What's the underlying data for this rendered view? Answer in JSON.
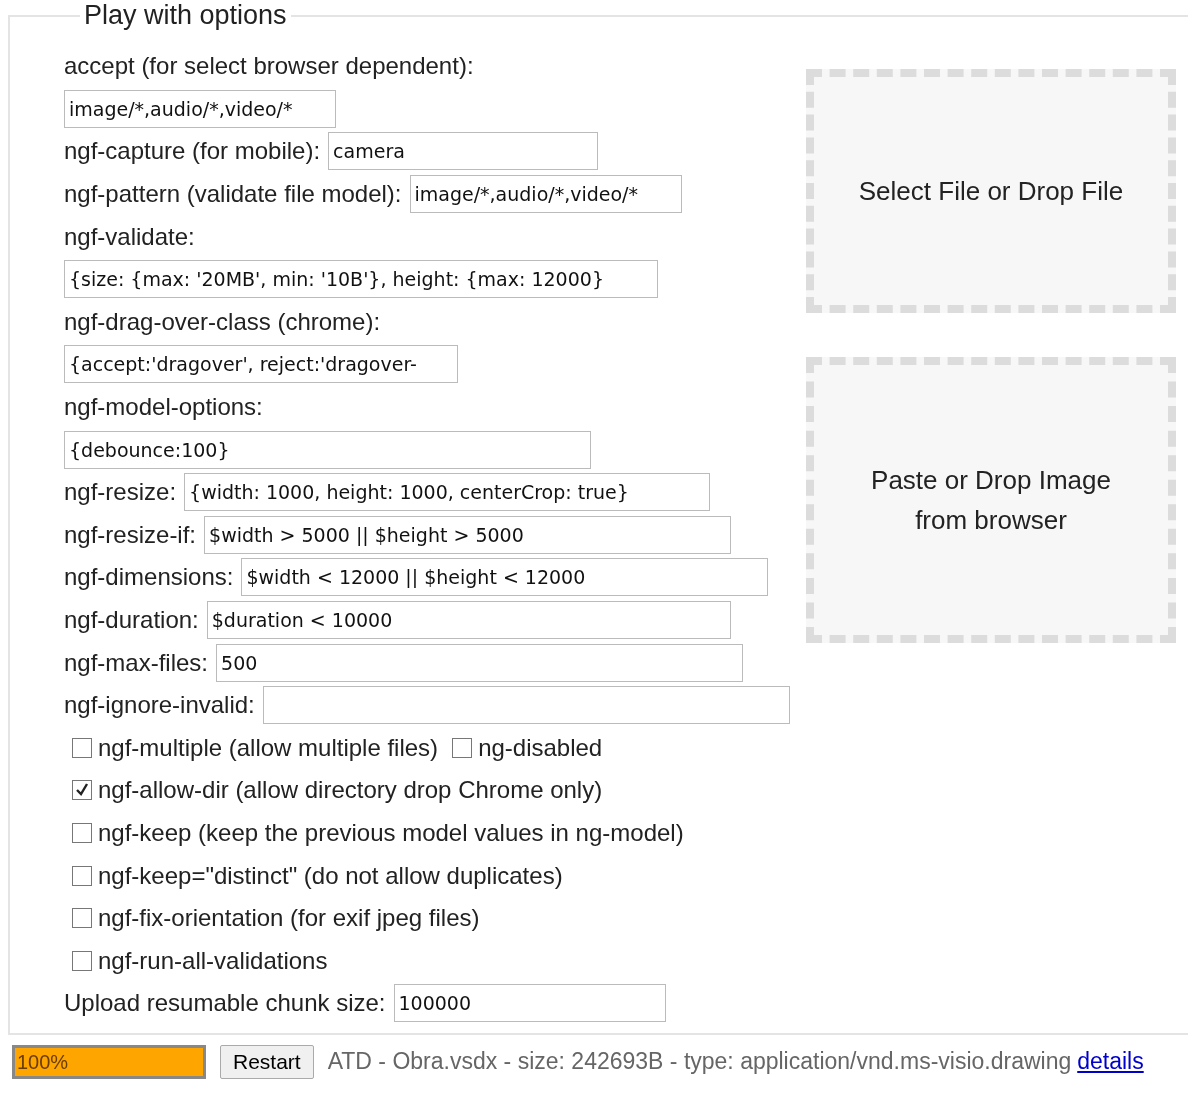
{
  "panel": {
    "title": "Play with options"
  },
  "fields": [
    {
      "kind": "stacked",
      "label": "accept (for select browser dependent):",
      "value": "image/*,audio/*,video/*"
    },
    {
      "kind": "inline",
      "label": "ngf-capture (for mobile):",
      "value": "camera"
    },
    {
      "kind": "inline",
      "label": "ngf-pattern (validate file model):",
      "value": "image/*,audio/*,video/*"
    },
    {
      "kind": "stacked",
      "label": "ngf-validate:",
      "value": "{size: {max: '20MB', min: '10B'}, height: {max: 12000}"
    },
    {
      "kind": "stacked",
      "label": "ngf-drag-over-class (chrome):",
      "value": "{accept:'dragover', reject:'dragover-"
    },
    {
      "kind": "stacked",
      "label": "ngf-model-options:",
      "value": "{debounce:100}"
    },
    {
      "kind": "inline",
      "label": "ngf-resize:",
      "value": "{width: 1000, height: 1000, centerCrop: true}"
    },
    {
      "kind": "inline",
      "label": "ngf-resize-if:",
      "value": "$width > 5000 || $height > 5000"
    },
    {
      "kind": "inline",
      "label": "ngf-dimensions:",
      "value": "$width < 12000 || $height < 12000"
    },
    {
      "kind": "inline",
      "label": "ngf-duration:",
      "value": "$duration < 10000"
    },
    {
      "kind": "inline",
      "label": "ngf-max-files:",
      "value": "500"
    },
    {
      "kind": "inline",
      "label": "ngf-ignore-invalid:"
    }
  ],
  "checkbox_rows": [
    [
      {
        "label": "ngf-multiple (allow multiple files)",
        "checked": false
      },
      {
        "label": "ng-disabled",
        "checked": false
      }
    ],
    [
      {
        "label": "ngf-allow-dir (allow directory drop Chrome only)",
        "checked": true
      }
    ],
    [
      {
        "label": "ngf-keep (keep the previous model values in ng-model)",
        "checked": false
      }
    ],
    [
      {
        "label": "ngf-keep=\"distinct\" (do not allow duplicates)",
        "checked": false
      }
    ],
    [
      {
        "label": "ngf-fix-orientation (for exif jpeg files)",
        "checked": false
      }
    ],
    [
      {
        "label": "ngf-run-all-validations",
        "checked": false
      }
    ]
  ],
  "chunk_field": {
    "label": "Upload resumable chunk size:",
    "value": "100000"
  },
  "drop_zones": [
    {
      "text": "Select File or Drop File"
    },
    {
      "text": "Paste or Drop Image from browser"
    }
  ],
  "upload": {
    "progress": {
      "level": 1,
      "text": "100%"
    },
    "restart_button": "Restart",
    "file_info": "ATD - Obra.vsdx - size: 242693B - type: application/vnd.ms-visio.drawing",
    "details_link": "details"
  }
}
